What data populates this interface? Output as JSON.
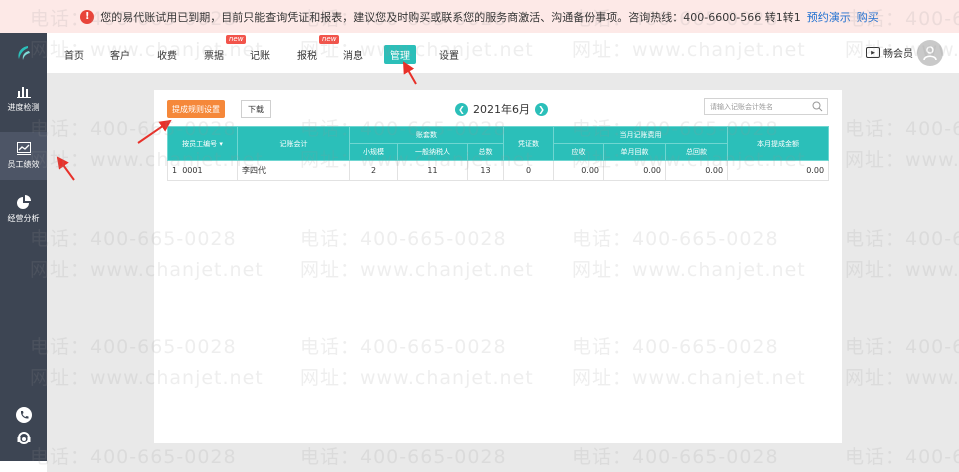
{
  "notice": {
    "text": "您的易代账试用已到期，目前只能查询凭证和报表，建议您及时购买或联系您的服务商激活、沟通备份事项。咨询热线：400-6600-566 转1转1",
    "demo_link": "预约演示",
    "buy_link": "购买"
  },
  "sidebar": {
    "items": [
      {
        "label": "进度检测",
        "icon": "bar-chart-icon"
      },
      {
        "label": "员工绩效",
        "icon": "line-chart-icon"
      },
      {
        "label": "经营分析",
        "icon": "pie-chart-icon"
      }
    ]
  },
  "nav": {
    "items": [
      "首页",
      "客户",
      "收费",
      "票据",
      "记账",
      "报税",
      "消息",
      "管理",
      "设置"
    ],
    "new_badge": "new",
    "active": "管理",
    "vip_label": "畅会员"
  },
  "toolbar": {
    "settings_button": "提成规则设置",
    "download_button": "下载",
    "month": "2021年6月",
    "search_placeholder": "请输入记账会计姓名"
  },
  "table": {
    "headers": {
      "employee_no": "按员工编号",
      "accountant": "记账会计",
      "account_count": "账套数",
      "small_scale": "小规模",
      "general_taxpayer": "一般纳税人",
      "total": "总数",
      "voucher_count": "凭证数",
      "monthly_fee": "当月记账费用",
      "receivable": "应收",
      "monthly_collected": "单月回款",
      "total_collected": "总回款",
      "commission_total": "本月提成金额"
    },
    "rows": [
      {
        "index": "1",
        "employee_no": "0001",
        "accountant": "李四代",
        "small_scale": "2",
        "general_taxpayer": "11",
        "total": "13",
        "voucher_count": "0",
        "receivable": "0.00",
        "monthly_collected": "0.00",
        "total_collected": "0.00",
        "commission": "0.00"
      }
    ]
  },
  "watermark": {
    "phone": "电话：400-665-0028",
    "site": "网址：www.chanjet.net"
  },
  "colors": {
    "accent": "#2bbfb9",
    "sidebar": "#3d4553",
    "orange": "#f5883a",
    "alert": "#e8443a"
  }
}
